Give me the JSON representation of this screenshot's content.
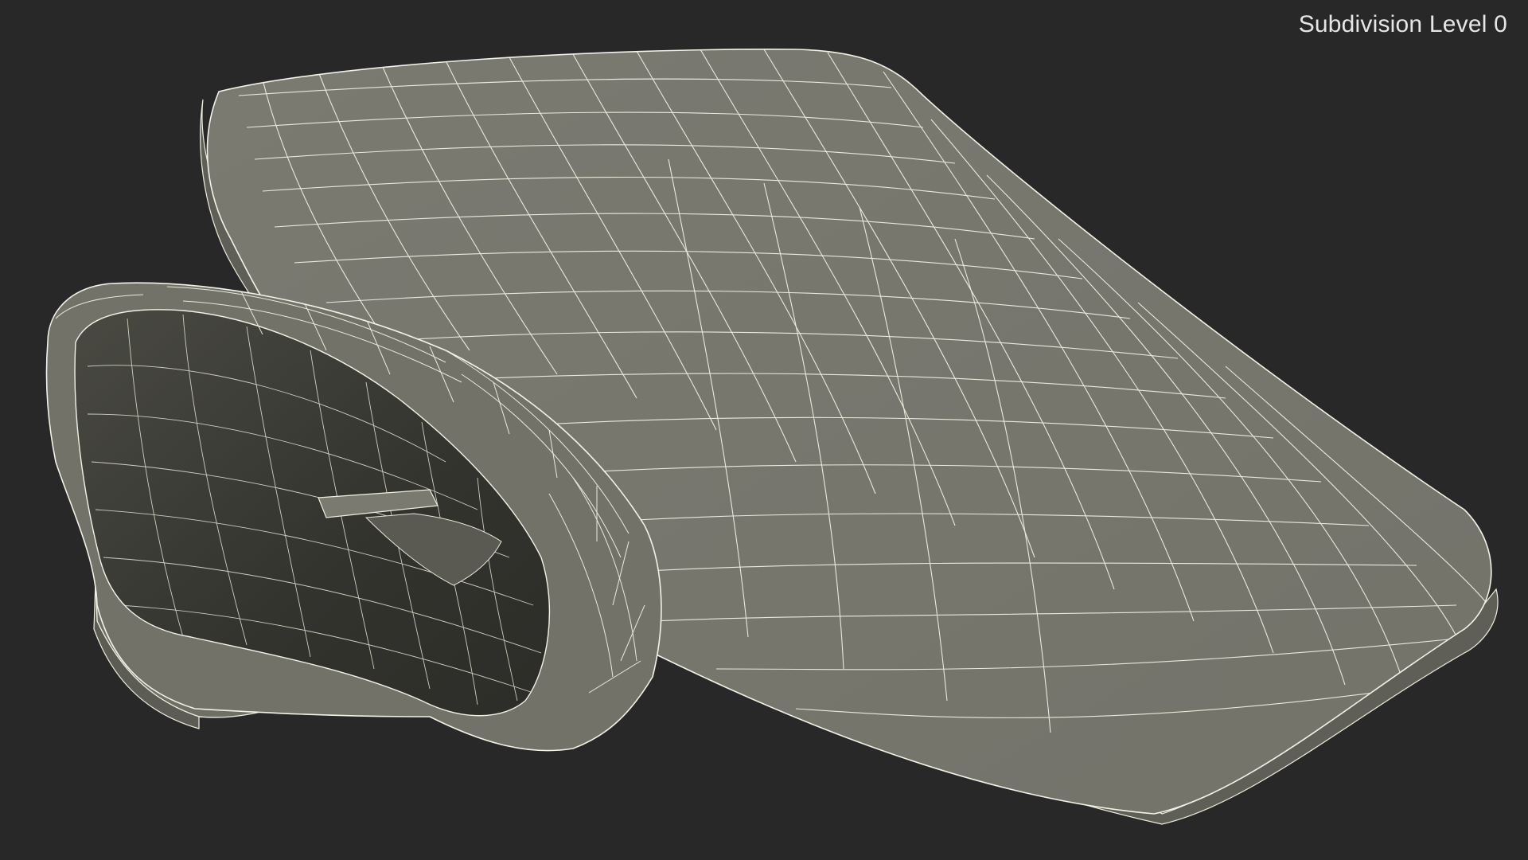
{
  "viewport": {
    "overlay_label": "Subdivision Level 0",
    "background_color": "#282828",
    "model": {
      "description": "wireframe-3d-model",
      "surface_color": "#787870",
      "shadow_color": "#3a3a34",
      "wire_color": "#f2f2e6"
    }
  }
}
